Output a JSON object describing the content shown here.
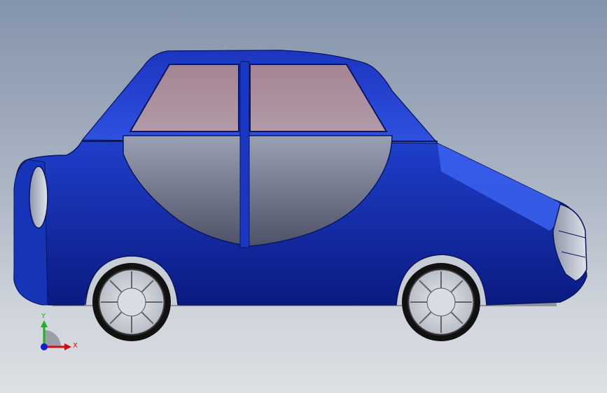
{
  "viewport": {
    "background_top": "#8494ab",
    "background_bottom": "#dcdfe3"
  },
  "model": {
    "body_color": "#1e3ec8",
    "body_dark": "#0c1f8e",
    "glass_color": "#a98c9a",
    "door_panel_color": "#6f7388",
    "rim_color": "#d6d9df",
    "tire_color": "#111111"
  },
  "triad": {
    "x_label": "X",
    "y_label": "Y",
    "x_color": "#d01010",
    "y_color": "#20b020",
    "z_color": "#1020d0"
  }
}
